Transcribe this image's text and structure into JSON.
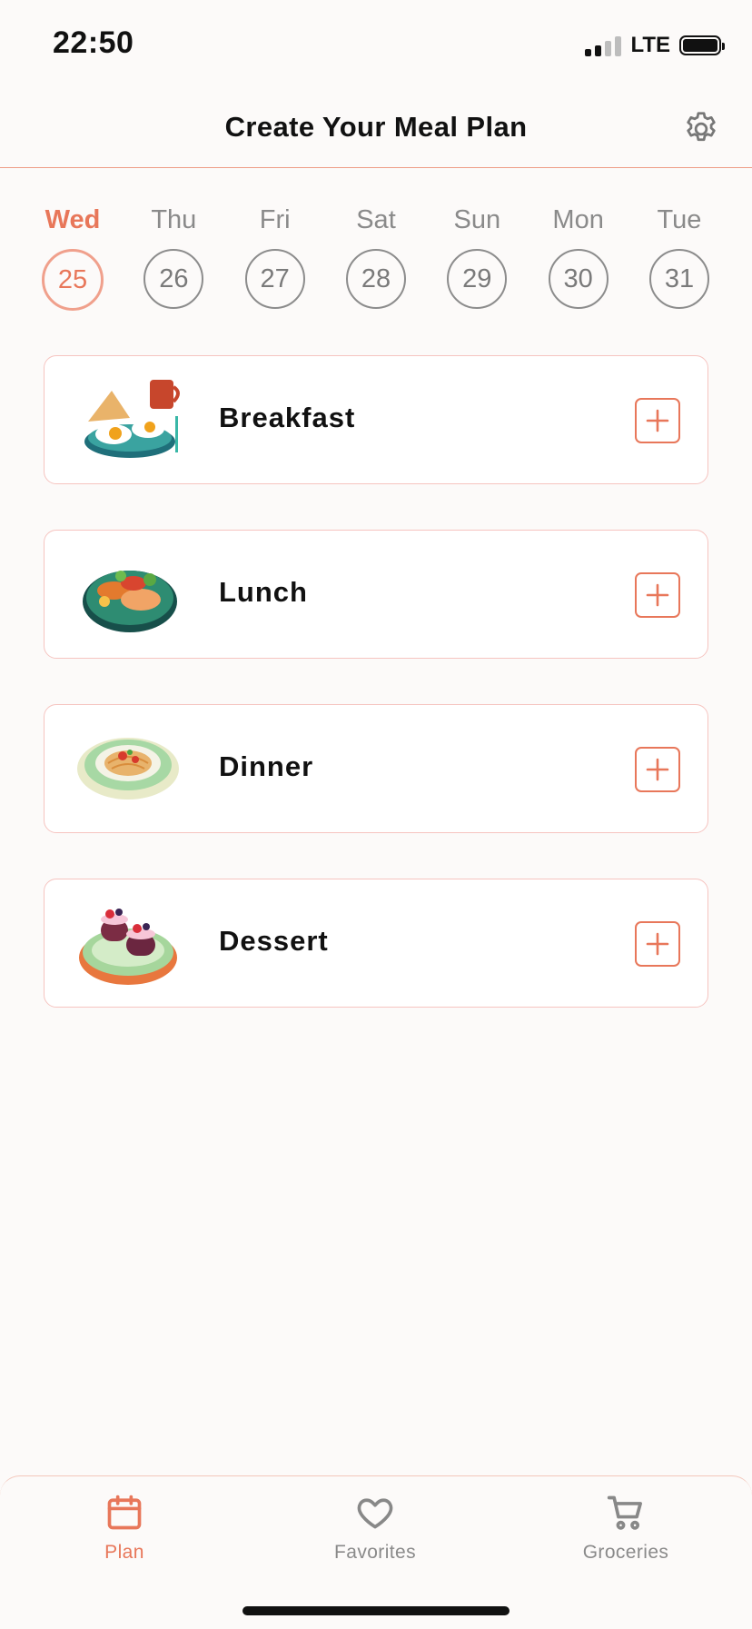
{
  "status_bar": {
    "time": "22:50",
    "network": "LTE"
  },
  "header": {
    "title": "Create Your Meal Plan"
  },
  "days": [
    {
      "name": "Wed",
      "number": "25",
      "selected": true
    },
    {
      "name": "Thu",
      "number": "26",
      "selected": false
    },
    {
      "name": "Fri",
      "number": "27",
      "selected": false
    },
    {
      "name": "Sat",
      "number": "28",
      "selected": false
    },
    {
      "name": "Sun",
      "number": "29",
      "selected": false
    },
    {
      "name": "Mon",
      "number": "30",
      "selected": false
    },
    {
      "name": "Tue",
      "number": "31",
      "selected": false
    }
  ],
  "meals": [
    {
      "label": "Breakfast",
      "icon": "breakfast-plate-icon"
    },
    {
      "label": "Lunch",
      "icon": "lunch-plate-icon"
    },
    {
      "label": "Dinner",
      "icon": "dinner-plate-icon"
    },
    {
      "label": "Dessert",
      "icon": "dessert-plate-icon"
    }
  ],
  "tabs": [
    {
      "label": "Plan",
      "icon": "calendar-icon",
      "active": true
    },
    {
      "label": "Favorites",
      "icon": "heart-icon",
      "active": false
    },
    {
      "label": "Groceries",
      "icon": "cart-icon",
      "active": false
    }
  ],
  "colors": {
    "accent": "#e8775a",
    "card_border": "#f6c4c0",
    "background": "#fcfaf9"
  }
}
